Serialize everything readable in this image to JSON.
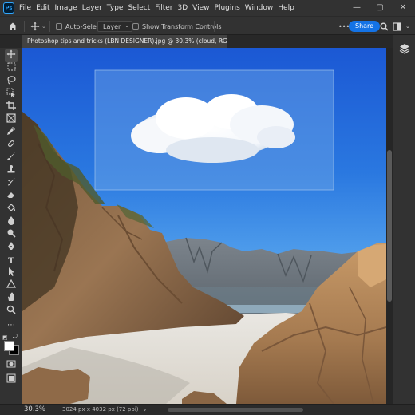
{
  "app": {
    "logo_text": "Ps",
    "menu": [
      "File",
      "Edit",
      "Image",
      "Layer",
      "Type",
      "Select",
      "Filter",
      "3D",
      "View",
      "Plugins",
      "Window",
      "Help"
    ],
    "window_controls": [
      "—",
      "▢",
      "✕"
    ]
  },
  "options_bar": {
    "auto_select_label": "Auto-Select:",
    "auto_select_target": "Layer",
    "show_transform_label": "Show Transform Controls",
    "more_label": "•••",
    "share_label": "Share"
  },
  "document": {
    "tab_title": "Photoshop tips and tricks (LBN DESIGNER).jpg @ 30.3% (cloud, RGB/8) *",
    "tab_close": "✕"
  },
  "tools": [
    "move-tool-icon",
    "artboard-tool-icon",
    "lasso-tool-icon",
    "object-select-tool-icon",
    "crop-tool-icon",
    "frame-tool-icon",
    "eyedropper-tool-icon",
    "healing-brush-icon",
    "brush-tool-icon",
    "clone-stamp-icon",
    "history-brush-icon",
    "eraser-tool-icon",
    "paint-bucket-icon",
    "blur-tool-icon",
    "dodge-tool-icon",
    "pen-tool-icon",
    "type-tool-icon",
    "path-select-icon",
    "shape-tool-icon",
    "hand-tool-icon",
    "zoom-tool-icon",
    "more-tools-icon"
  ],
  "status": {
    "zoom": "30.3%",
    "doc_info": "3024 px x 4032 px (72 ppi)",
    "arrow": "›"
  },
  "colors": {
    "accent": "#1473e6",
    "panel": "#323232",
    "sky_top": "#1b58d4"
  }
}
